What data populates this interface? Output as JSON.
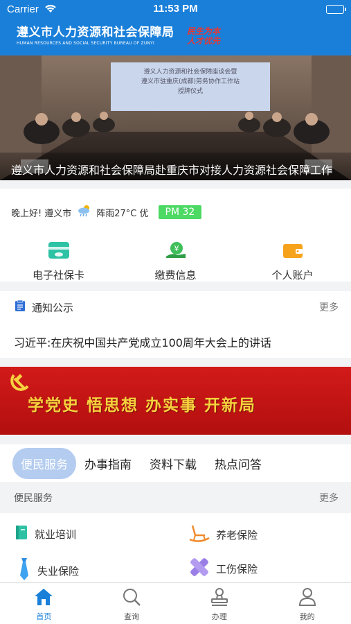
{
  "status_bar": {
    "carrier": "Carrier",
    "time": "11:53 PM"
  },
  "header": {
    "title_cn": "遵义市人力资源和社会保障局",
    "title_en": "HUMAN RESOURCES AND SOCIAL SECURITY BUREAU OF ZUNYI",
    "slogan": "民生为本 人才优先",
    "bg_color": "#1a7fd9"
  },
  "banner": {
    "screen_text": "遵义人力资源和社会保障座谈会暨 遵义市驻重庆(成都)劳务协作工作站 授牌仪式",
    "caption": "遵义市人力资源和社会保障局赴重庆市对接人力资源社会保障工作"
  },
  "info": {
    "greeting": "晚上好!",
    "city": "遵义市",
    "weather": "阵雨27°C 优",
    "weather_icon": "cloud-rain-icon",
    "pm": "PM 32",
    "pm_color": "#4cd964"
  },
  "quick_links": [
    {
      "label": "电子社保卡",
      "icon": "social-security-card-icon"
    },
    {
      "label": "缴费信息",
      "icon": "payment-icon"
    },
    {
      "label": "个人账户",
      "icon": "wallet-icon"
    }
  ],
  "notice": {
    "title": "通知公示",
    "more": "更多",
    "item": "习近平:在庆祝中国共产党成立100周年大会上的讲话"
  },
  "party_banner": {
    "text": "学党史 悟思想 办实事 开新局"
  },
  "tabs": [
    {
      "label": "便民服务",
      "active": true
    },
    {
      "label": "办事指南",
      "active": false
    },
    {
      "label": "资料下载",
      "active": false
    },
    {
      "label": "热点问答",
      "active": false
    }
  ],
  "services": {
    "title": "便民服务",
    "more": "更多",
    "items": [
      {
        "label": "就业培训",
        "icon": "book-icon"
      },
      {
        "label": "养老保险",
        "icon": "rocking-chair-icon"
      },
      {
        "label": "失业保险",
        "icon": "tie-icon"
      },
      {
        "label": "工伤保险",
        "icon": "bandage-icon"
      }
    ]
  },
  "tabbar": [
    {
      "label": "首页",
      "icon": "home-icon",
      "active": true
    },
    {
      "label": "查询",
      "icon": "search-icon",
      "active": false
    },
    {
      "label": "办理",
      "icon": "stamp-icon",
      "active": false
    },
    {
      "label": "我的",
      "icon": "user-icon",
      "active": false
    }
  ]
}
